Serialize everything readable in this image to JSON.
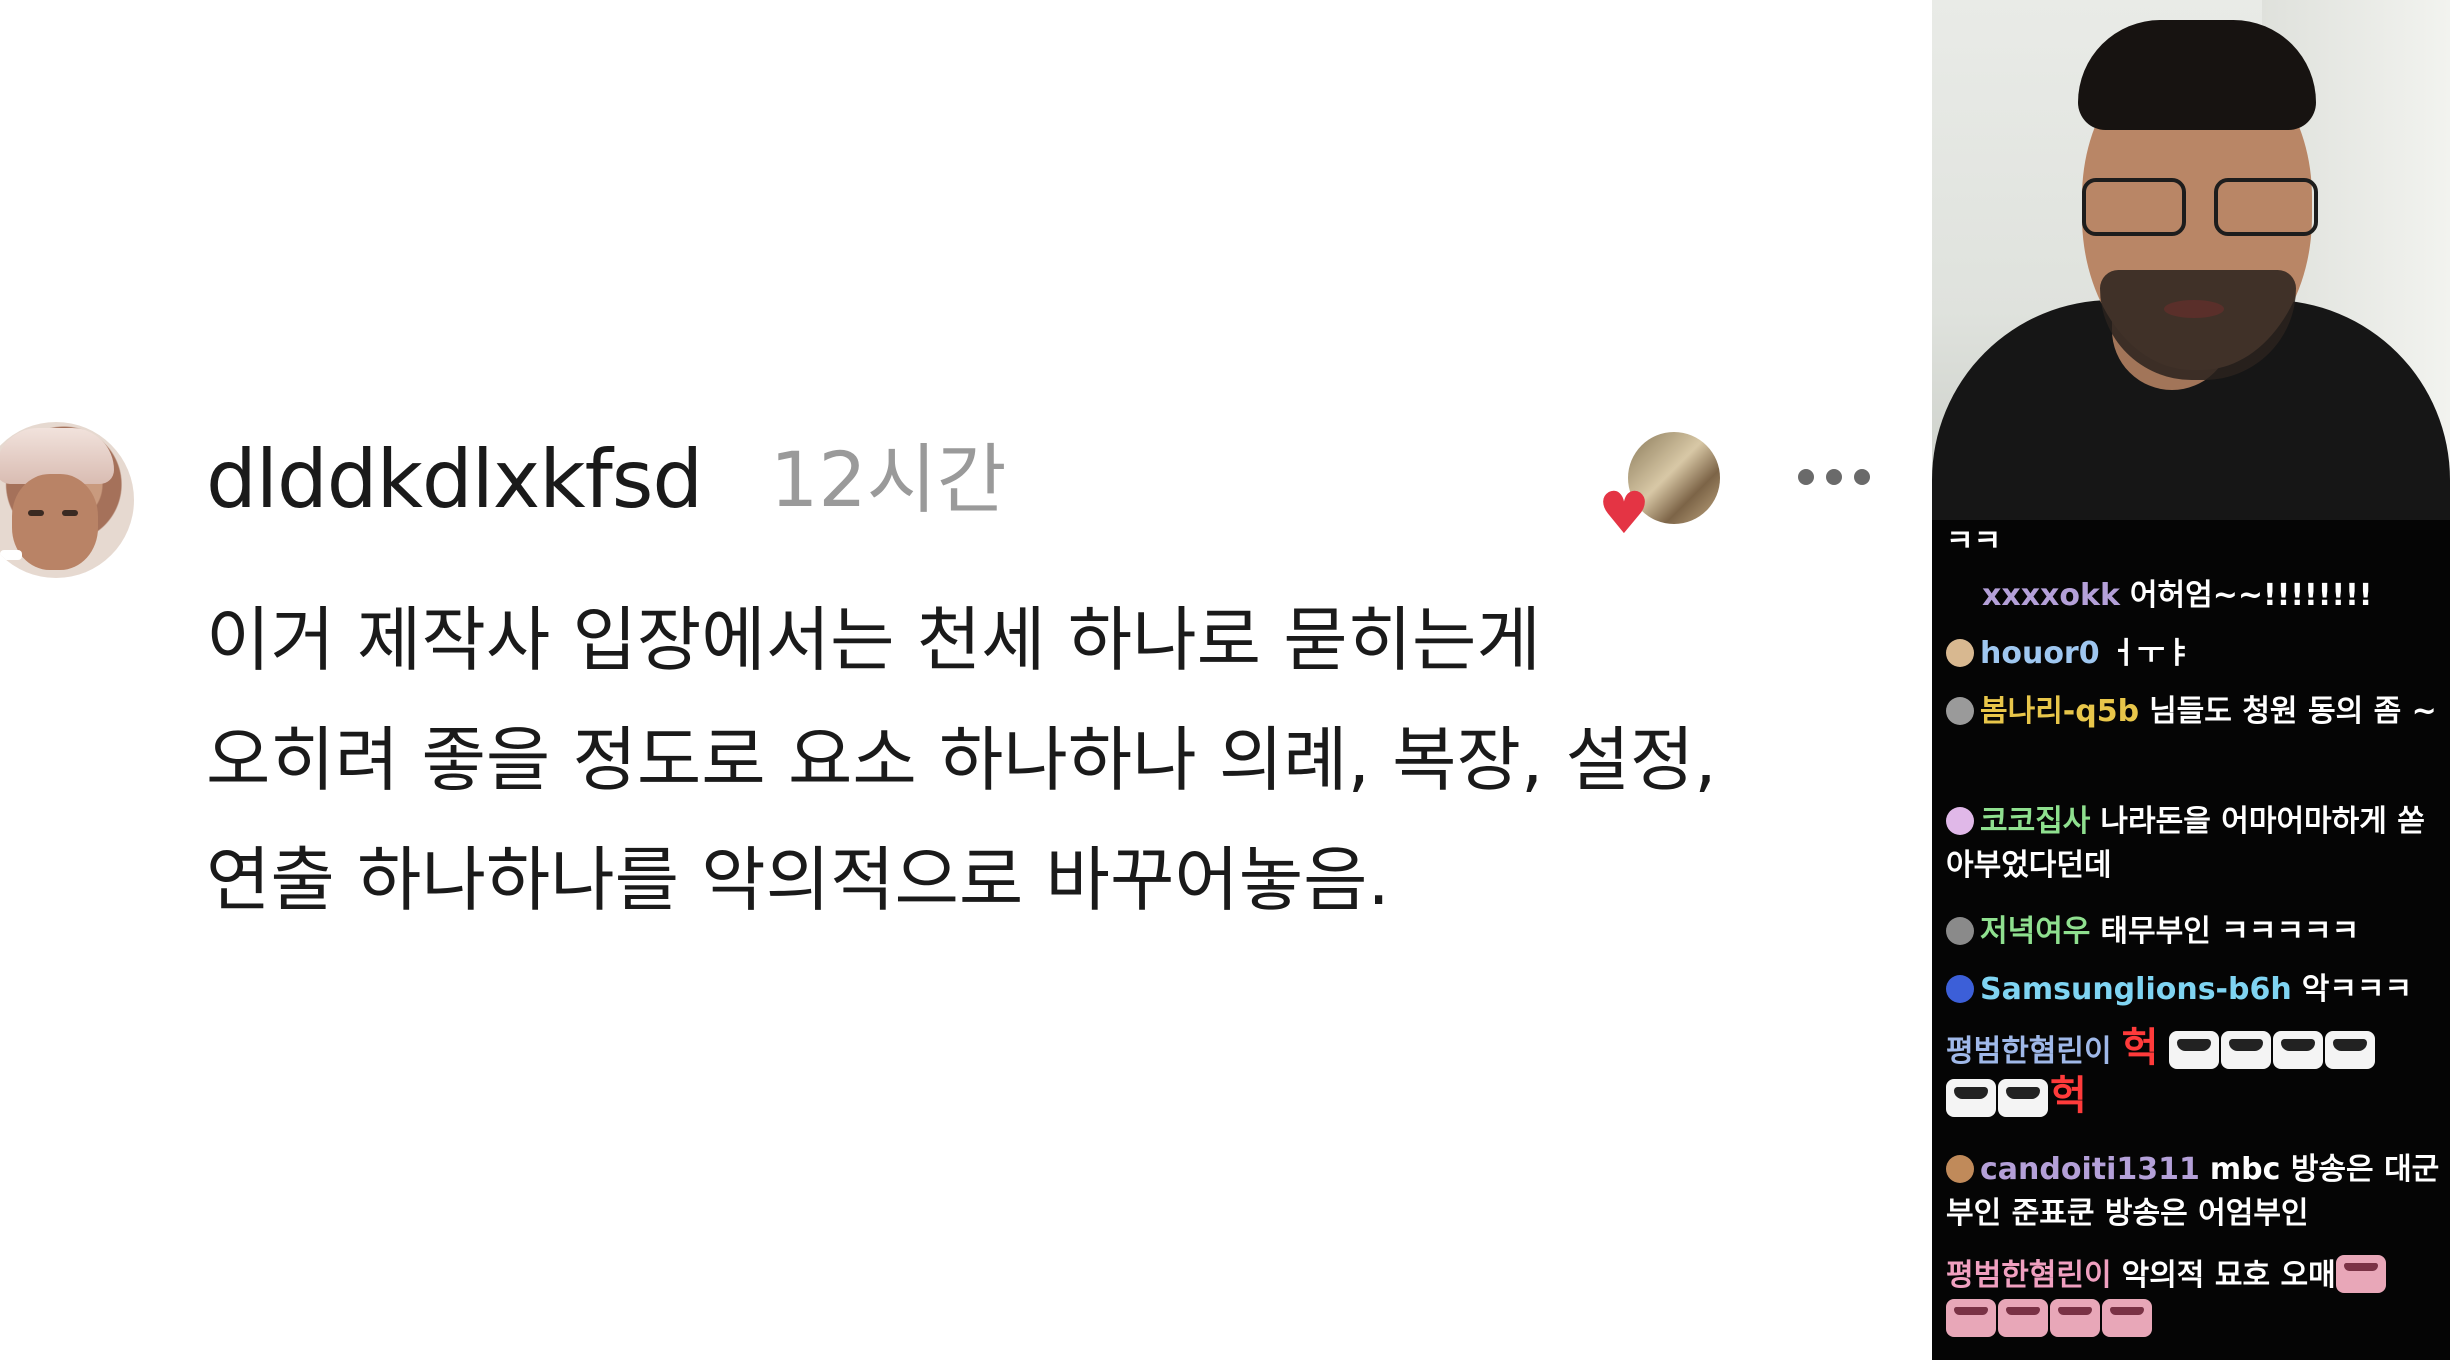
{
  "comment": {
    "username": "dlddkdlxkfsd",
    "timestamp": "12시간",
    "lines": [
      "이거 제작사 입장에서는 천세 하나로 묻히는게",
      "오히려 좋을 정도로 요소 하나하나 의례, 복장, 설정,",
      "연출 하나하나를 악의적으로 바꾸어놓음."
    ],
    "heart_glyph": "♥",
    "icons": {
      "more": "more-options-icon",
      "heart": "creator-heart-icon"
    }
  },
  "chat": {
    "messages": [
      {
        "nick": "",
        "text": "ㅋㅋ",
        "nick_color": "#ffffff"
      },
      {
        "nick": "xxxxokk",
        "text": "어허엄~~!!!!!!!!",
        "nick_color": "#b4a0d8"
      },
      {
        "nick": "houor0",
        "text": "ㅓㅜㅑ",
        "nick_color": "#9fc7f0"
      },
      {
        "nick": "봄나리-q5b",
        "text": "님들도 청원 동의 좀 ~",
        "nick_color": "#e8c64a"
      },
      {
        "nick": "코코집사",
        "text": "나라돈을 어마어마하게 쏟아부었다던데",
        "nick_color": "#8fe08f"
      },
      {
        "nick": "저녁여우",
        "text": "태무부인 ㅋㅋㅋㅋㅋ",
        "nick_color": "#8fe08f"
      },
      {
        "nick": "Samsunglions-b6h",
        "text": "악ㅋㅋㅋ",
        "nick_color": "#7fd4f2"
      },
      {
        "nick": "평범한혐린이",
        "text": "헉",
        "text2": "헉",
        "nick_color": "#9fb8e8"
      },
      {
        "nick": "candoiti1311",
        "text": "mbc 방송은 대군부인 준표쿤 방송은 어엄부인",
        "nick_color": "#b4a0d8"
      },
      {
        "nick": "평범한혐린이",
        "text": "악의적 묘호 오매",
        "nick_color": "#f0a0c0"
      }
    ]
  }
}
